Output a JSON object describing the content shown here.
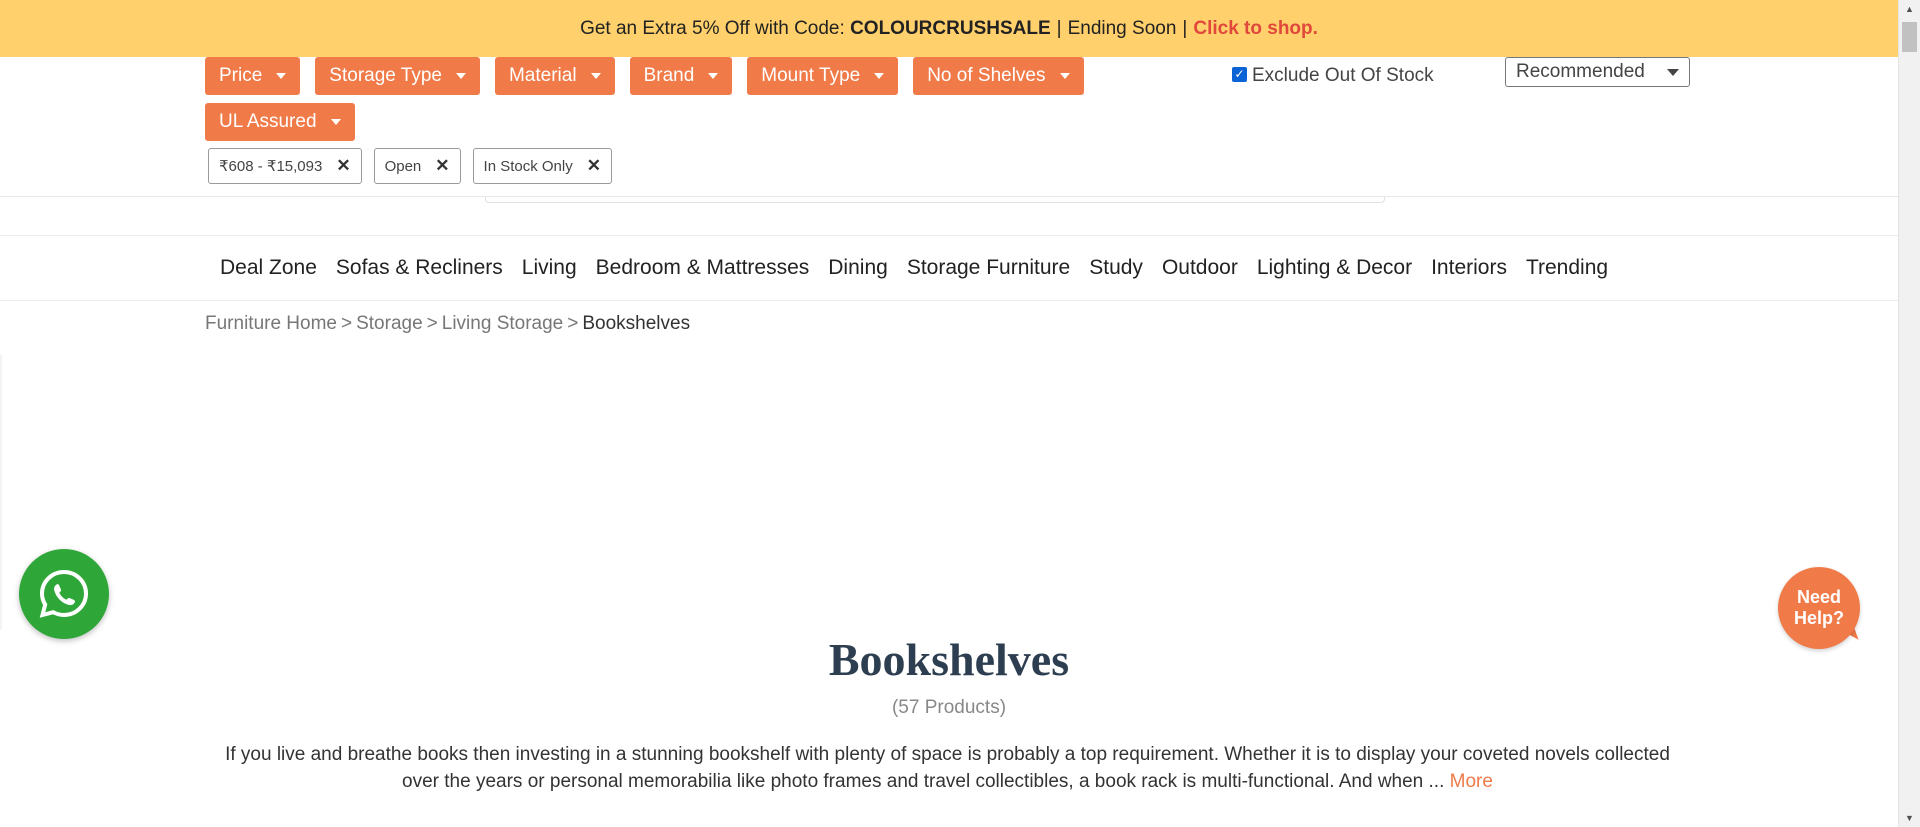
{
  "promo": {
    "text": "Get an Extra 5% Off with Code:",
    "code": "COLOURCRUSHSALE",
    "divider": "|",
    "ending": "Ending Soon",
    "cta": "Click to shop."
  },
  "filters": {
    "chips": [
      {
        "label": "Price"
      },
      {
        "label": "Storage Type"
      },
      {
        "label": "Material"
      },
      {
        "label": "Brand"
      },
      {
        "label": "Mount Type"
      },
      {
        "label": "No of Shelves"
      },
      {
        "label": "UL Assured"
      }
    ],
    "active": [
      {
        "label": "₹608 - ₹15,093"
      },
      {
        "label": "Open"
      },
      {
        "label": "In Stock Only"
      }
    ],
    "remove_glyph": "✕",
    "exclude_oos": {
      "label": "Exclude Out Of Stock",
      "checked": true
    },
    "sort": {
      "value": "Recommended"
    }
  },
  "nav": {
    "items": [
      "Deal Zone",
      "Sofas & Recliners",
      "Living",
      "Bedroom & Mattresses",
      "Dining",
      "Storage Furniture",
      "Study",
      "Outdoor",
      "Lighting & Decor",
      "Interiors",
      "Trending"
    ]
  },
  "breadcrumb": {
    "items": [
      "Furniture Home",
      "Storage",
      "Living Storage",
      "Bookshelves"
    ],
    "separator": ">"
  },
  "help": {
    "line1": "Need",
    "line2": "Help?"
  },
  "listing": {
    "title": "Bookshelves",
    "count": "(57 Products)",
    "description": "If you live and breathe books then investing in a stunning bookshelf with plenty of space is probably a top requirement. Whether it is to display your coveted novels collected over the years or personal memorabilia like photo frames and travel collectibles, a book rack is multi-functional. And when ...",
    "more": "More"
  },
  "colors": {
    "accent": "#f07a48",
    "promo_bg": "#ffd06b",
    "promo_cta": "#e0483c",
    "whatsapp": "#2fa738"
  },
  "icons": [
    "whatsapp-icon",
    "caret-down-icon",
    "close-icon",
    "checkbox-checked-icon"
  ]
}
